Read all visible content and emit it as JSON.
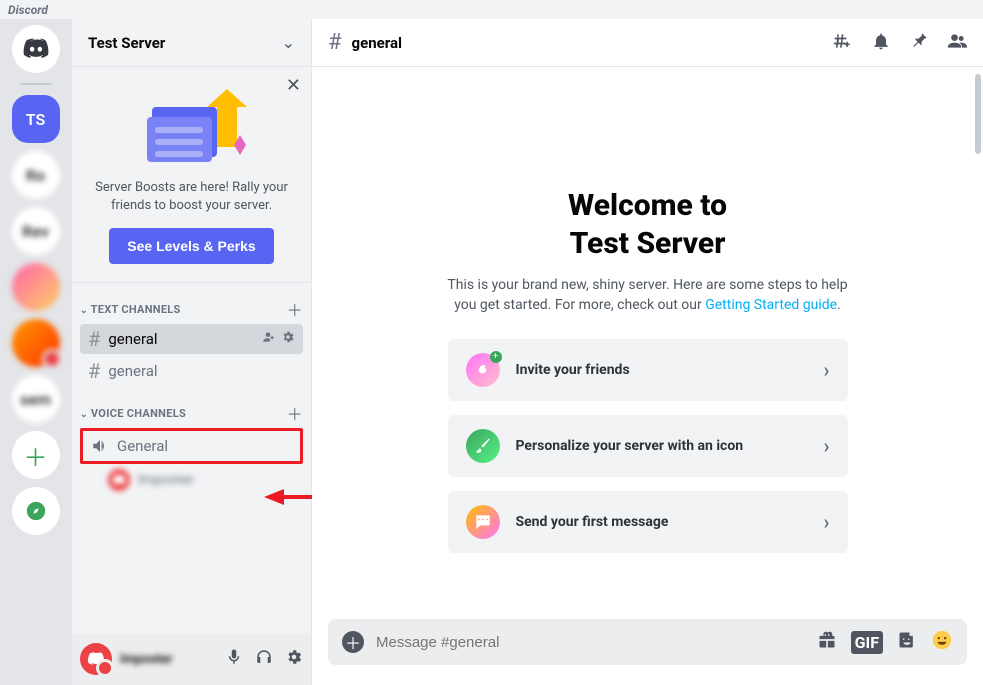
{
  "brand": "Discord",
  "rail": {
    "selected_guild_initials": "TS"
  },
  "server": {
    "name": "Test Server"
  },
  "boost": {
    "line1": "Server Boosts are here! Rally your",
    "line2": "friends to boost your server.",
    "button": "See Levels & Perks"
  },
  "categories": {
    "text_label": "TEXT CHANNELS",
    "voice_label": "VOICE CHANNELS"
  },
  "channels": {
    "text": [
      {
        "name": "general",
        "selected": true
      },
      {
        "name": "general",
        "selected": false
      }
    ],
    "voice": [
      {
        "name": "General"
      }
    ]
  },
  "header": {
    "channel_name": "general"
  },
  "welcome": {
    "title_line1": "Welcome to",
    "title_line2": "Test Server",
    "desc_a": "This is your brand new, shiny server. Here are some steps to help",
    "desc_b": "you get started. For more, check out our ",
    "link": "Getting Started guide",
    "period": "."
  },
  "cards": {
    "invite": "Invite your friends",
    "personalize": "Personalize your server with an icon",
    "first_msg": "Send your first message"
  },
  "composer": {
    "placeholder": "Message #general"
  }
}
